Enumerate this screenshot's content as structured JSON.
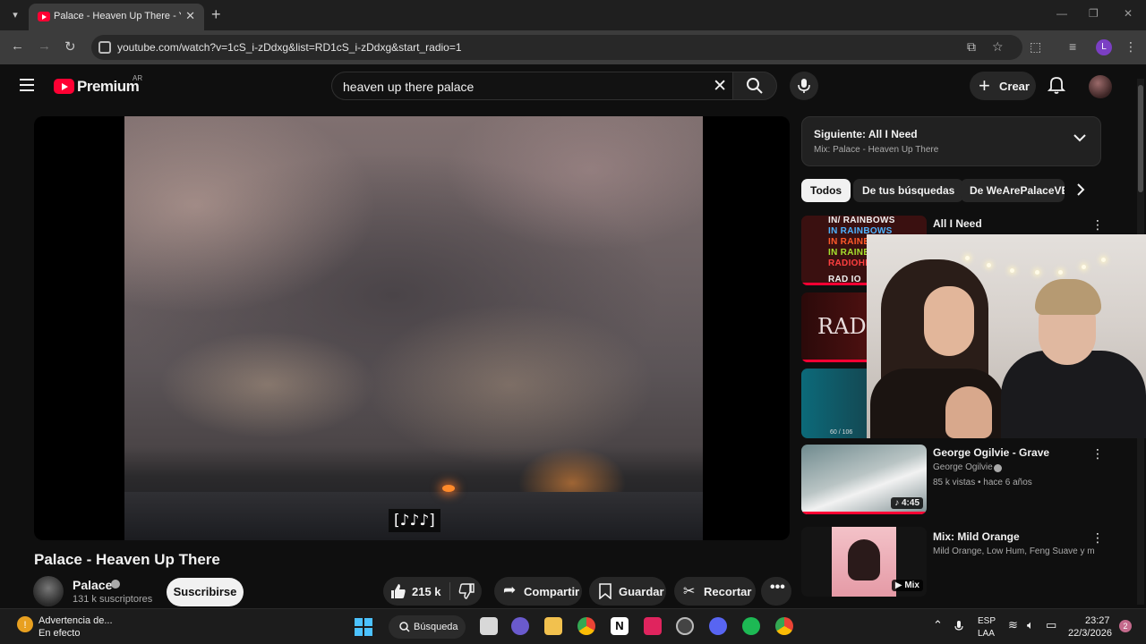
{
  "browser": {
    "tab_title": "Palace - Heaven Up There - YouTube",
    "url": "youtube.com/watch?v=1cS_i-zDdxg&list=RD1cS_i-zDdxg&start_radio=1",
    "profile_initial": "L"
  },
  "header": {
    "brand": "Premium",
    "region": "AR",
    "search_value": "heaven up there palace",
    "create_label": "Crear"
  },
  "player": {
    "caption": "[♪♪♪]"
  },
  "video": {
    "title": "Palace - Heaven Up There",
    "channel": "Palace",
    "subscribers": "131 k suscriptores",
    "subscribe_label": "Suscribirse",
    "likes": "215 k",
    "share_label": "Compartir",
    "save_label": "Guardar",
    "clip_label": "Recortar"
  },
  "sidebar": {
    "next_label": "Siguiente: All I Need",
    "next_sub": "Mix: Palace - Heaven Up There",
    "chips": [
      "Todos",
      "De tus búsquedas",
      "De WeArePalaceVEVO"
    ],
    "recs": [
      {
        "title": "All I Need",
        "thumb_text": [
          "IN/ RAINBOWS",
          "IN RAINBOWS",
          "IN RAINBOWS",
          "IN RAINB",
          "RADIOHE",
          "RAD IO"
        ]
      },
      {
        "thumb_text": "RADIO"
      },
      {
        "thumb_badge": "60 / 106"
      },
      {
        "title": "George Ogilvie - Grave",
        "channel": "George Ogilvie",
        "meta": "85 k vistas • hace 6 años",
        "duration": "4:45"
      },
      {
        "title": "Mix: Mild Orange",
        "channel": "Mild Orange, Low Hum, Feng Suave y mu...",
        "badge": "Mix"
      }
    ]
  },
  "taskbar": {
    "warning_title": "Advertencia de...",
    "warning_sub": "En efecto",
    "search_label": "Búsqueda",
    "lang_top": "ESP",
    "lang_bottom": "LAA",
    "time": "23:27",
    "date": "22/3/2026",
    "notif_count": "2"
  },
  "colors": {
    "accent": "#ff0033",
    "background": "#0f0f0f",
    "surface": "#272727"
  }
}
